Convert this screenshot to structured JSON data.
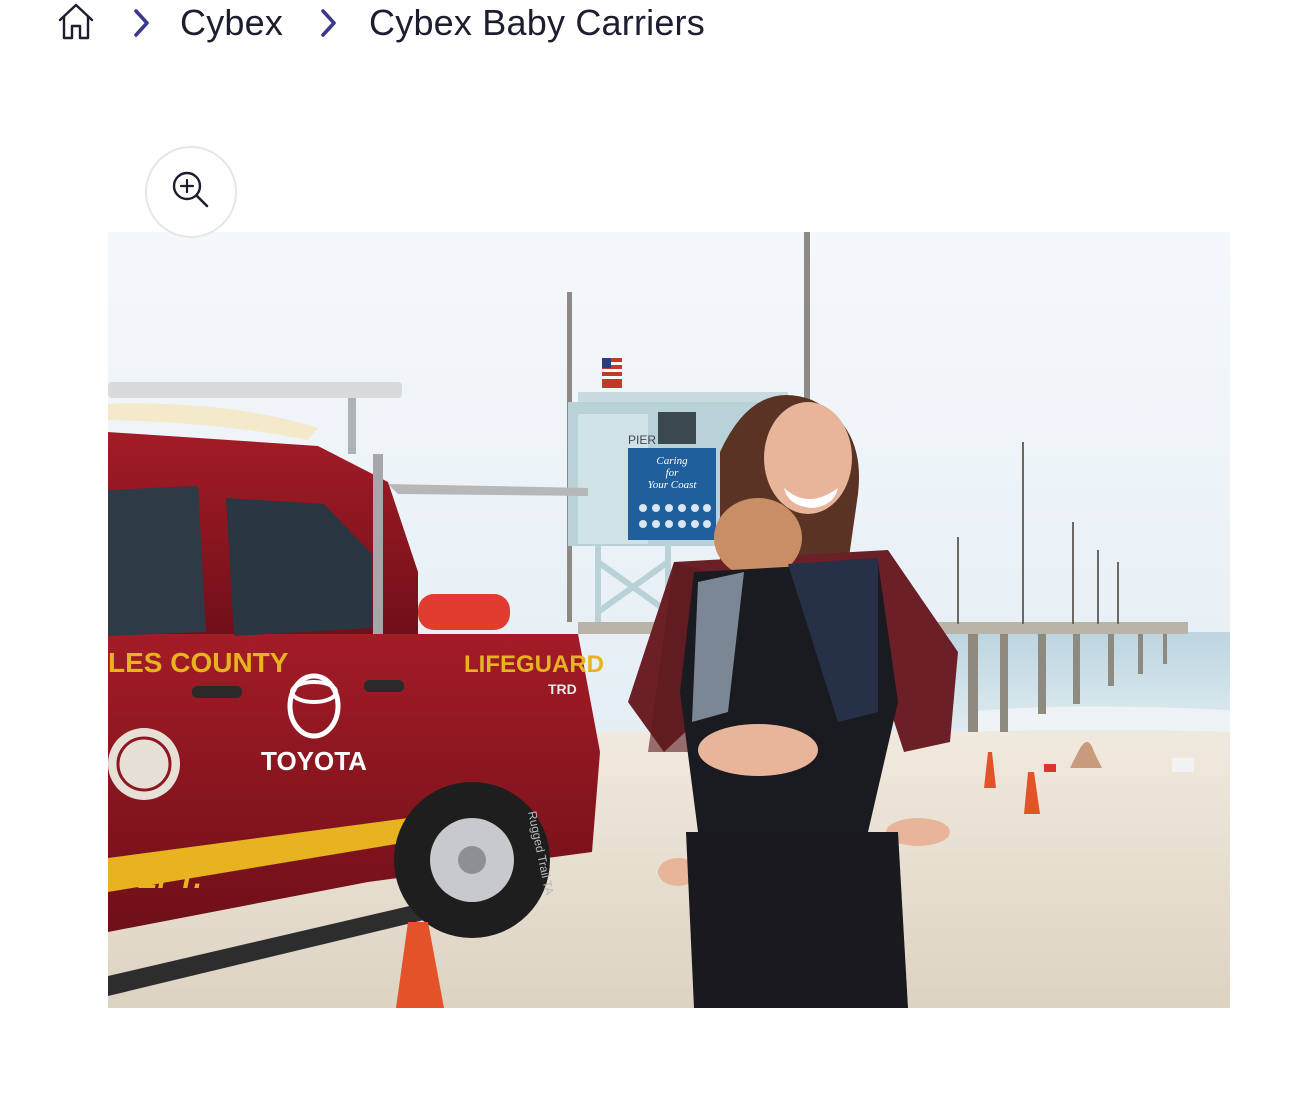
{
  "breadcrumb": {
    "home_icon": "home-icon",
    "separator_icon": "chevron-right-icon",
    "items": [
      {
        "label": "Cybex"
      },
      {
        "label": "Cybex Baby Carriers"
      }
    ]
  },
  "gallery": {
    "zoom_icon": "zoom-in-icon",
    "image": {
      "vehicle_text": {
        "county": "LES COUNTY",
        "brand": "TOYOTA",
        "unit": "LIFEGUARD",
        "dept": "DEPT.",
        "trd": "TRD",
        "tire": "Rugged Trail TA"
      },
      "tower_text": {
        "pier": "PIER",
        "sign_line1": "Caring",
        "sign_line2": "for",
        "sign_line3": "Your Coast"
      }
    }
  },
  "colors": {
    "accent_chevron": "#3a3a8c",
    "text": "#1c1d2e",
    "truck_red": "#8e1620",
    "truck_stripe": "#e7b320",
    "sky": "#e9f1f6",
    "sand": "#e9e1d4",
    "cone": "#e4522a"
  }
}
